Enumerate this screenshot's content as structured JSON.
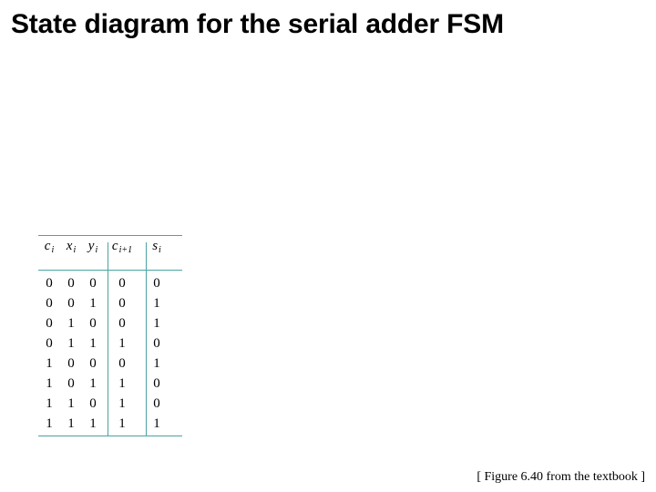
{
  "title": "State diagram for the serial adder FSM",
  "caption": "[ Figure 6.40 from the textbook ]",
  "chart_data": {
    "type": "table",
    "columns": [
      {
        "var": "c",
        "sub": "i"
      },
      {
        "var": "x",
        "sub": "i"
      },
      {
        "var": "y",
        "sub": "i"
      },
      {
        "var": "c",
        "sub": "i+1"
      },
      {
        "var": "s",
        "sub": "i"
      }
    ],
    "rows": [
      [
        0,
        0,
        0,
        0,
        0
      ],
      [
        0,
        0,
        1,
        0,
        1
      ],
      [
        0,
        1,
        0,
        0,
        1
      ],
      [
        0,
        1,
        1,
        1,
        0
      ],
      [
        1,
        0,
        0,
        0,
        1
      ],
      [
        1,
        0,
        1,
        1,
        0
      ],
      [
        1,
        1,
        0,
        1,
        0
      ],
      [
        1,
        1,
        1,
        1,
        1
      ]
    ]
  }
}
